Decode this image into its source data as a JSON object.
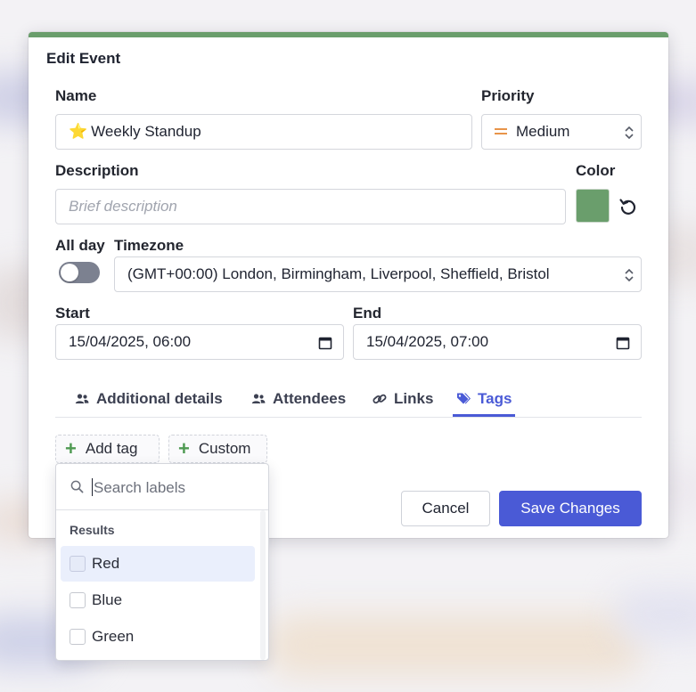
{
  "modal": {
    "title": "Edit Event",
    "accent_color": "#6a9e6c"
  },
  "name": {
    "label": "Name",
    "emoji": "⭐",
    "value": "Weekly Standup"
  },
  "priority": {
    "label": "Priority",
    "value": "Medium",
    "icon": "equals-icon"
  },
  "description": {
    "label": "Description",
    "placeholder": "Brief description",
    "value": ""
  },
  "color": {
    "label": "Color",
    "value": "#6a9e6c"
  },
  "all_day": {
    "label": "All day",
    "checked": false
  },
  "timezone": {
    "label": "Timezone",
    "value": "(GMT+00:00) London, Birmingham, Liverpool, Sheffield, Bristol"
  },
  "start": {
    "label": "Start",
    "value": "15/04/2025, 06:00"
  },
  "end": {
    "label": "End",
    "value": "15/04/2025, 07:00"
  },
  "tabs": [
    {
      "label": "Additional details",
      "icon": "users-icon",
      "active": false
    },
    {
      "label": "Attendees",
      "icon": "users-icon",
      "active": false
    },
    {
      "label": "Links",
      "icon": "link-icon",
      "active": false
    },
    {
      "label": "Tags",
      "icon": "tags-icon",
      "active": true
    }
  ],
  "tag_actions": {
    "add_tag": "Add tag",
    "custom": "Custom"
  },
  "buttons": {
    "cancel": "Cancel",
    "save": "Save Changes"
  },
  "dropdown": {
    "search_placeholder": "Search labels",
    "section_title": "Results",
    "options": [
      {
        "label": "Red",
        "checked": false
      },
      {
        "label": "Blue",
        "checked": false
      },
      {
        "label": "Green",
        "checked": false
      }
    ]
  },
  "colors": {
    "primary": "#4a5ad6",
    "success": "#4f9a52",
    "priority_icon": "#e8944a"
  }
}
